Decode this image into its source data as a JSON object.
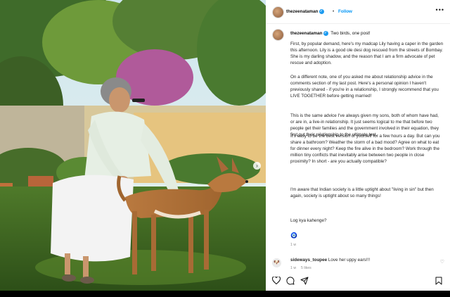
{
  "post": {
    "author": "thezeenataman",
    "follow_label": "Follow",
    "more_label": "•••",
    "caption_title": "Two birds, one post!",
    "paragraphs": [
      "First, by popular demand, here's my madcap Lily having a caper in the garden this afternoon. Lily is a good ole desi dog rescued from the streets of Bombay. She is my darling shadow, and the reason that I am a firm advocate of pet rescue and adoption.",
      "On a different note, one of you asked me about relationship advice in the comments section of my last post. Here's a personal opinion I haven't previously shared - if you're in a relationship, I strongly recommend that you LIVE TOGETHER before getting married!",
      "This is the same advice I've always given my sons, both of whom have had, or are in, a live-in relationship. It just seems logical to me that before two people get their families and the government involved in their equation, they first put their relationship to the ultimate test.",
      "It's easy to be the best version of yourself for a few hours a day. But can you share a bathroom? Weather the storm of a bad mood? Agree on what to eat for dinner every night? Keep the fire alive in the bedroom? Work through the million tiny conflicts that inevitably arise between two people in close proximity? In short - are you actually compatible?",
      "I'm aware that Indian society is a little uptight about \"living in sin\" but then again, society is uptight about so many things!",
      "Log kya kahenge?"
    ],
    "emoji": "🧿",
    "time_ago": "1 w"
  },
  "comment": {
    "user": "sideways_toupee",
    "text": "Love her uppy ears!!!",
    "time_ago": "1 w",
    "likes": "5 likes"
  },
  "icons": {
    "like": "heart-icon",
    "comment": "comment-icon",
    "share": "share-icon",
    "save": "bookmark-icon",
    "next": "chevron-right-icon"
  }
}
